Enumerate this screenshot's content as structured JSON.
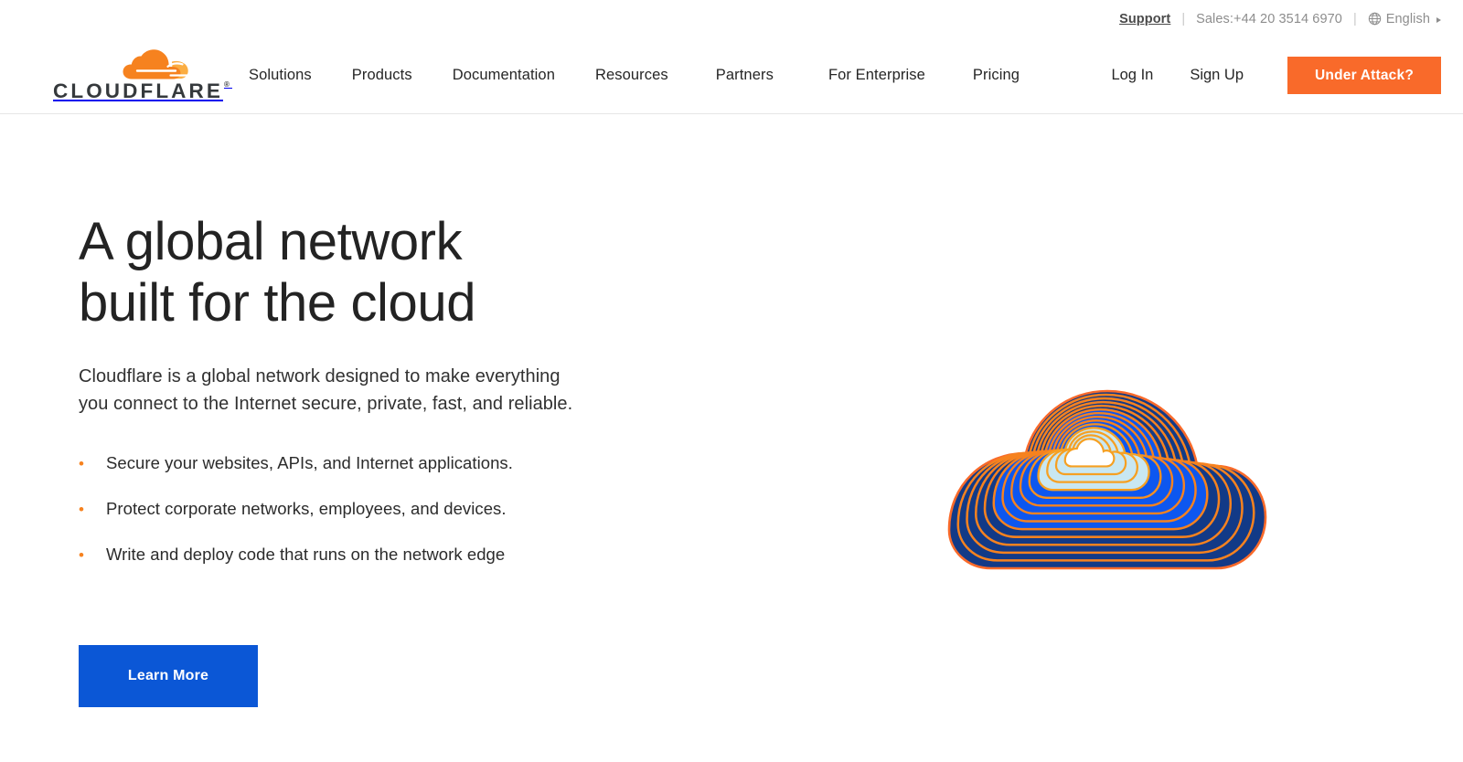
{
  "utility_bar": {
    "support_label": "Support",
    "separator": "|",
    "sales_label": "Sales:+44 20 3514 6970",
    "language_label": "English",
    "globe_icon": "globe-icon",
    "caret_icon": "caret-right-icon"
  },
  "logo": {
    "wordmark": "CLOUDFLARE",
    "registered_mark": "®",
    "cloud_icon": "cloudflare-cloud-icon",
    "cloud_color_main": "#f6821f",
    "cloud_color_accent": "#fbad41",
    "wordmark_color": "#35393c"
  },
  "nav": {
    "links": [
      {
        "label": "Solutions"
      },
      {
        "label": "Products"
      },
      {
        "label": "Documentation"
      },
      {
        "label": "Resources"
      },
      {
        "label": "Partners"
      },
      {
        "label": "For Enterprise"
      },
      {
        "label": "Pricing"
      }
    ],
    "log_in_label": "Log In",
    "sign_up_label": "Sign Up",
    "under_attack_label": "Under Attack?",
    "under_attack_color": "#f96a2a"
  },
  "hero": {
    "title_line1": "A global network",
    "title_line2": "built for the cloud",
    "subtitle_line1": "Cloudflare is a global network designed to make everything",
    "subtitle_line2": "you connect to the Internet secure, private, fast, and reliable.",
    "bullets": [
      {
        "marker": "•",
        "text": "Secure your websites, APIs, and Internet applications."
      },
      {
        "marker": "•",
        "text": "Protect corporate networks, employees, and devices."
      },
      {
        "marker": "•",
        "text": "Write and deploy code that runs on the network edge"
      }
    ],
    "learn_more_label": "Learn More",
    "learn_more_color": "#0b57d6",
    "illustration": {
      "name": "concentric-cloud-illustration",
      "ring_count": 14,
      "colors": {
        "navy": "#123a87",
        "blue": "#0d57ef",
        "cyan": "#c8e7f2",
        "center": "#ffffff",
        "stroke_outer": "#f96a2a",
        "stroke_inner": "#f6a022"
      }
    }
  }
}
